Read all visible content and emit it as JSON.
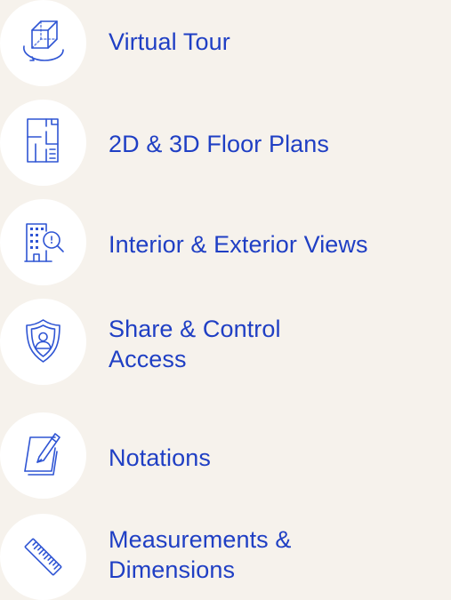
{
  "features": [
    {
      "label": "Virtual Tour",
      "icon": "cube-rotate-icon"
    },
    {
      "label": "2D & 3D Floor Plans",
      "icon": "floor-plan-icon"
    },
    {
      "label": "Interior & Exterior Views",
      "icon": "building-search-icon"
    },
    {
      "label_line1": "Share & Control",
      "label_line2": "Access",
      "icon": "shield-user-icon"
    },
    {
      "label": "Notations",
      "icon": "notepad-pencil-icon"
    },
    {
      "label_line1": "Measurements &",
      "label_line2": "Dimensions",
      "icon": "ruler-icon"
    }
  ],
  "colors": {
    "background": "#f6f2ec",
    "icon_circle": "#ffffff",
    "accent": "#1f3fc4",
    "icon_stroke": "#2f55d4"
  }
}
